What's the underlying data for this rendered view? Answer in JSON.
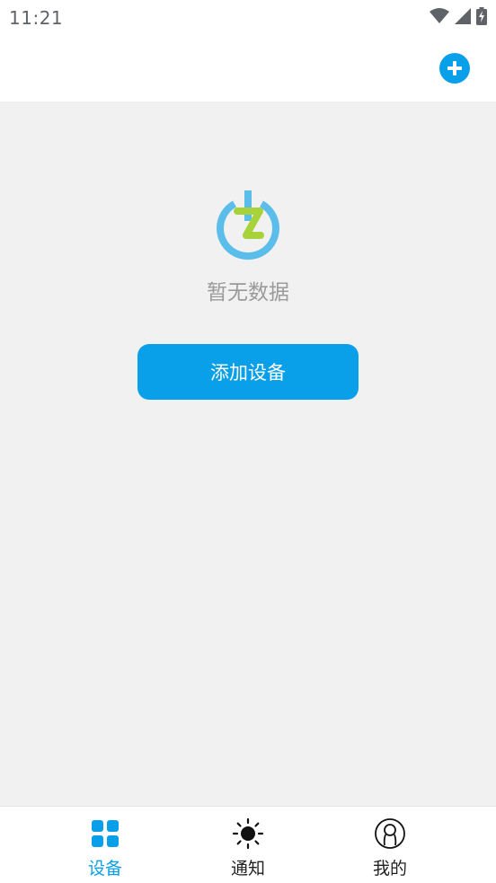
{
  "status_bar": {
    "time": "11:21",
    "icons": [
      "wifi-icon",
      "cell-signal-icon",
      "battery-charging-icon"
    ]
  },
  "app_bar": {
    "action_icon": "plus-circle-icon"
  },
  "empty_state": {
    "logo_icon": "power-z-logo",
    "message": "暂无数据",
    "button_label": "添加设备"
  },
  "tab_bar": {
    "tabs": [
      {
        "label": "设备",
        "icon": "grid-icon",
        "active": true
      },
      {
        "label": "通知",
        "icon": "sun-icon",
        "active": false
      },
      {
        "label": "我的",
        "icon": "user-icon",
        "active": false
      }
    ]
  },
  "colors": {
    "accent": "#0aa0e9",
    "background": "#f1f1f1",
    "logo_ring": "#5bbde9",
    "logo_z": "#a8d23a"
  }
}
